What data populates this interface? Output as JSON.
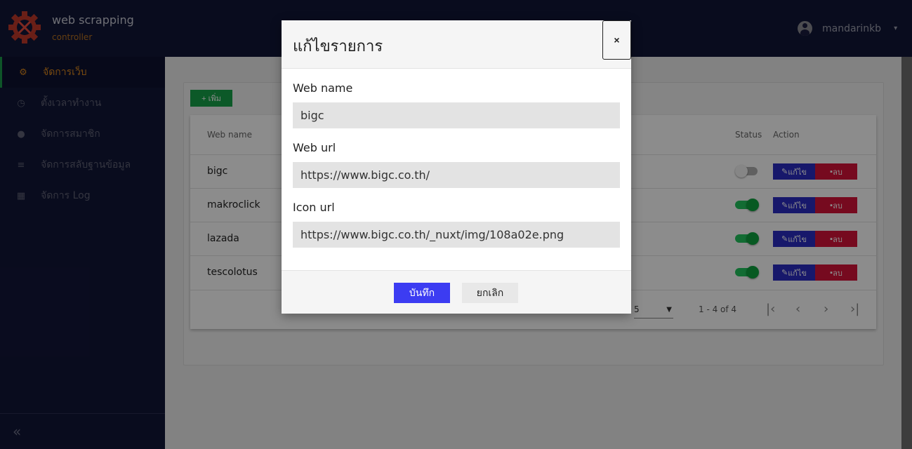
{
  "header": {
    "brand_title": "web scrapping",
    "brand_subtitle": "controller",
    "user_name": "mandarinkb",
    "user_caret": "▾"
  },
  "sidebar": {
    "items": [
      {
        "icon": "gear-icon",
        "label": "จัดการเว็บ",
        "active": true
      },
      {
        "icon": "clock-icon",
        "label": "ตั้งเวลาทำงาน",
        "active": false
      },
      {
        "icon": "users-icon",
        "label": "จัดการสมาชิก",
        "active": false
      },
      {
        "icon": "database-icon",
        "label": "จัดการสลับฐานข้อมูล",
        "active": false
      },
      {
        "icon": "calendar-icon",
        "label": "จัดการ Log",
        "active": false
      }
    ],
    "collapse_glyph": "«"
  },
  "main": {
    "add_button": "+ เพิ่ม",
    "columns": {
      "web_name": "Web name",
      "status": "Status",
      "action": "Action"
    },
    "rows": [
      {
        "name": "bigc",
        "status_on": false
      },
      {
        "name": "makroclick",
        "status_on": true
      },
      {
        "name": "lazada",
        "status_on": true
      },
      {
        "name": "tescolotus",
        "status_on": true
      }
    ],
    "edit_label": "แก้ไข",
    "delete_label": "ลบ",
    "per_page": "5",
    "range_text": "1 - 4 of 4"
  },
  "modal": {
    "title": "แก้ไขรายการ",
    "close_glyph": "×",
    "fields": {
      "web_name_label": "Web name",
      "web_name_value": "bigc",
      "web_url_label": "Web url",
      "web_url_value": "https://www.bigc.co.th/",
      "icon_url_label": "Icon url",
      "icon_url_value": "https://www.bigc.co.th/_nuxt/img/108a02e.png"
    },
    "save_label": "บันทึก",
    "cancel_label": "ยกเลิก"
  },
  "colors": {
    "navy": "#121638",
    "accent_orange": "#d9861e",
    "primary_blue": "#3c3cf2",
    "success_green": "#16a34a",
    "danger_red": "#d8133a"
  }
}
